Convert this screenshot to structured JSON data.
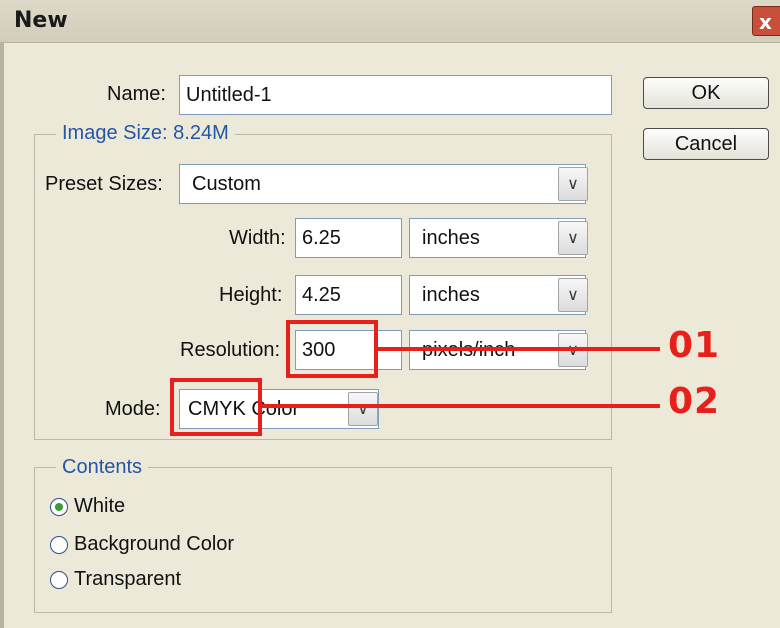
{
  "window": {
    "title": "New",
    "close_glyph": "x"
  },
  "name_field": {
    "label": "Name:",
    "value": "Untitled-1"
  },
  "image_size": {
    "legend": "Image Size: 8.24M"
  },
  "preset": {
    "label": "Preset Sizes:",
    "value": "Custom"
  },
  "width": {
    "label": "Width:",
    "value": "6.25",
    "unit": "inches"
  },
  "height": {
    "label": "Height:",
    "value": "4.25",
    "unit": "inches"
  },
  "resolution": {
    "label": "Resolution:",
    "value": "300",
    "unit": "pixels/inch"
  },
  "mode": {
    "label": "Mode:",
    "value": "CMYK Color"
  },
  "buttons": {
    "ok": "OK",
    "cancel": "Cancel"
  },
  "contents": {
    "legend": "Contents",
    "options": [
      "White",
      "Background Color",
      "Transparent"
    ],
    "selected": "White"
  },
  "callouts": [
    "01",
    "02"
  ],
  "colors": {
    "annotation": "#e8201c",
    "legend_text": "#2456a4",
    "dialog_bg": "#ece9d8"
  },
  "icons": {
    "dropdown": "chevron-down-icon",
    "close": "close-icon"
  }
}
